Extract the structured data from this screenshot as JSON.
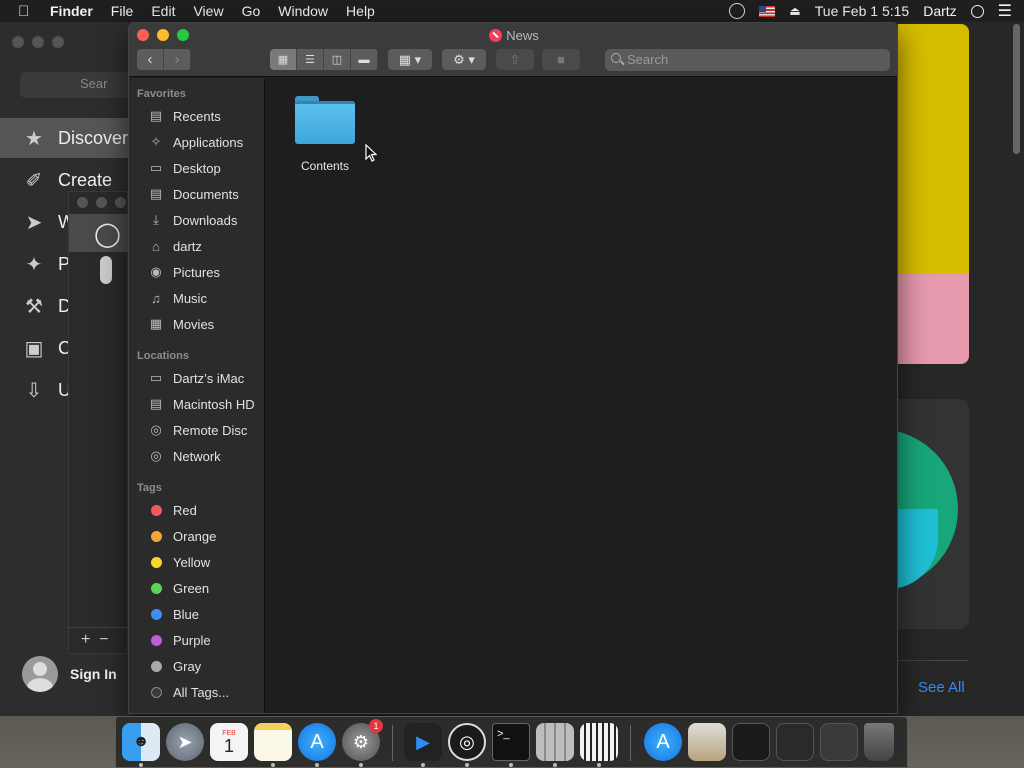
{
  "menubar": {
    "app_name": "Finder",
    "menus": [
      "File",
      "Edit",
      "View",
      "Go",
      "Window",
      "Help"
    ],
    "datetime": "Tue Feb 1  5:15",
    "user": "Dartz"
  },
  "background_app": {
    "search_placeholder": "Sear",
    "nav": [
      "Discover",
      "Create",
      "W",
      "P",
      "D",
      "C",
      "U"
    ],
    "sign_in": "Sign In",
    "see_all": "See All"
  },
  "finder": {
    "title": "News",
    "search_placeholder": "Search",
    "sidebar": {
      "favorites_header": "Favorites",
      "favorites": [
        {
          "label": "Recents",
          "icon": "recents-icon"
        },
        {
          "label": "Applications",
          "icon": "applications-icon"
        },
        {
          "label": "Desktop",
          "icon": "desktop-icon"
        },
        {
          "label": "Documents",
          "icon": "documents-icon"
        },
        {
          "label": "Downloads",
          "icon": "downloads-icon"
        },
        {
          "label": "dartz",
          "icon": "home-icon"
        },
        {
          "label": "Pictures",
          "icon": "pictures-icon"
        },
        {
          "label": "Music",
          "icon": "music-icon"
        },
        {
          "label": "Movies",
          "icon": "movies-icon"
        }
      ],
      "locations_header": "Locations",
      "locations": [
        {
          "label": "Dartz’s iMac",
          "icon": "imac-icon"
        },
        {
          "label": "Macintosh HD",
          "icon": "disk-icon"
        },
        {
          "label": "Remote Disc",
          "icon": "remote-disc-icon"
        },
        {
          "label": "Network",
          "icon": "network-icon"
        }
      ],
      "tags_header": "Tags",
      "tags": [
        {
          "label": "Red",
          "color": "#f4575d"
        },
        {
          "label": "Orange",
          "color": "#f6a433"
        },
        {
          "label": "Yellow",
          "color": "#f7d72b"
        },
        {
          "label": "Green",
          "color": "#59d454"
        },
        {
          "label": "Blue",
          "color": "#3c8ef5"
        },
        {
          "label": "Purple",
          "color": "#c15bdb"
        },
        {
          "label": "Gray",
          "color": "#a8a8a8"
        },
        {
          "label": "All Tags...",
          "color": ""
        }
      ]
    },
    "items": [
      {
        "name": "Contents",
        "kind": "folder"
      }
    ]
  },
  "dock": {
    "apps": [
      "Finder",
      "Launchpad",
      "Calendar",
      "Notes",
      "App Store",
      "System Preferences",
      "Transporter",
      "OBS",
      "Terminal",
      "Calculator",
      "Piano",
      "App Store",
      "Preview",
      "Window",
      "Window",
      "Utilities",
      "Trash"
    ],
    "calendar_month": "FEB",
    "calendar_day": "1",
    "sysprefs_badge": "1"
  }
}
